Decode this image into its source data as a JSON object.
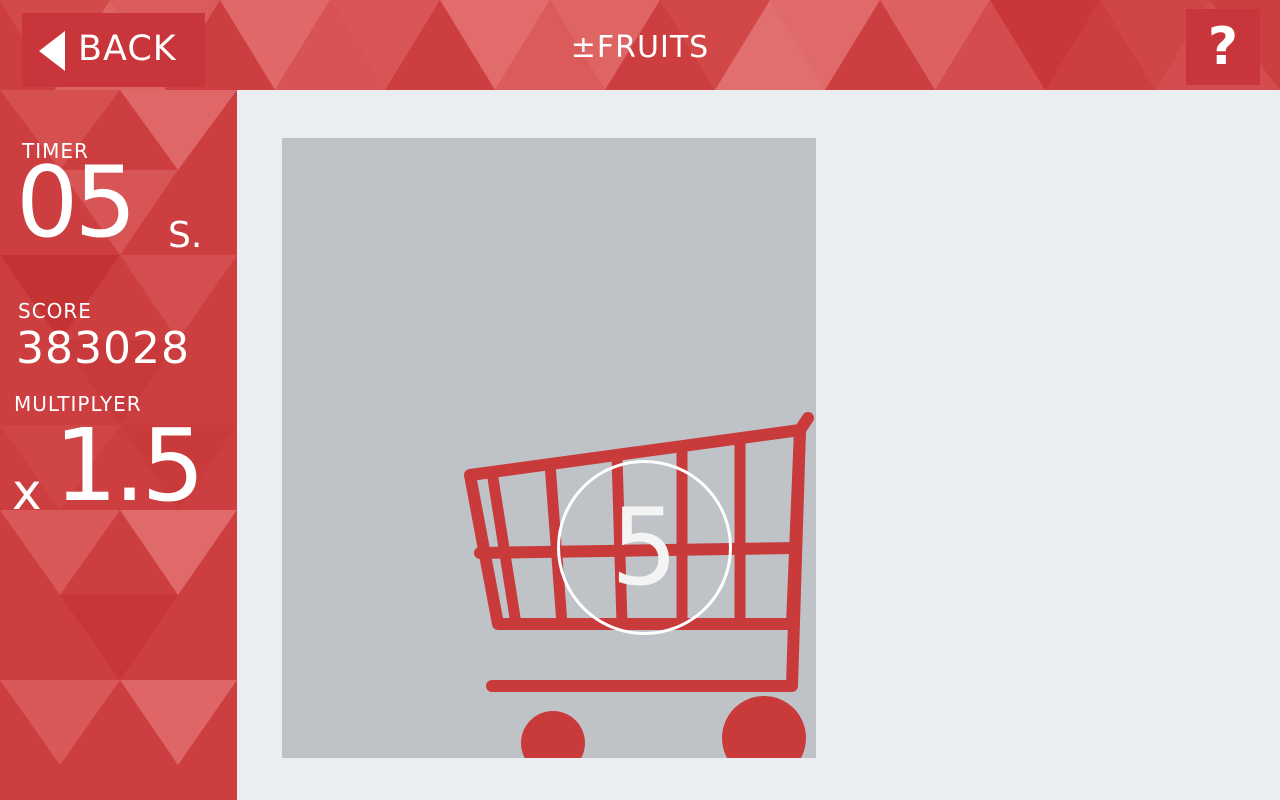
{
  "colors": {
    "primary_red": "#c93a3a",
    "panel_bg": "#ebeef0",
    "card_bg": "#bfc3c7"
  },
  "header": {
    "back_label": "BACK",
    "title": "±FRUITS",
    "help_label": "?"
  },
  "stats": {
    "timer_label": "TIMER",
    "timer_value": "05",
    "timer_unit": "S.",
    "score_label": "SCORE",
    "score_value": "383028",
    "multiplier_label": "MULTIPLYER",
    "multiplier_prefix": "x",
    "multiplier_value": "1.5"
  },
  "game": {
    "countdown": "5",
    "icons": [
      "arrow-left-icon",
      "shopping-cart-icon"
    ]
  }
}
